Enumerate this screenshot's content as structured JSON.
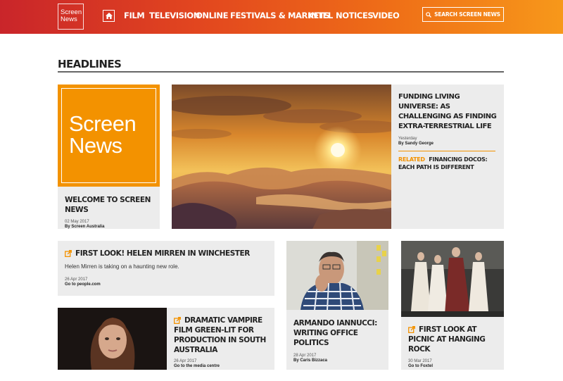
{
  "header": {
    "logo_line1": "Screen",
    "logo_line2": "News",
    "nav": [
      "FILM",
      "TELEVISION",
      "ONLINE",
      "FESTIVALS & MARKETS",
      "INTEL",
      "NOTICES",
      "VIDEO"
    ],
    "search_label": "SEARCH SCREEN NEWS"
  },
  "section": {
    "title": "HEADLINES"
  },
  "welcome": {
    "logo_line1": "Screen",
    "logo_line2": "News",
    "title": "WELCOME TO SCREEN NEWS",
    "date": "02 May 2017",
    "byline": "By Screen Australia"
  },
  "feature": {
    "title": "FUNDING LIVING UNIVERSE: AS CHALLENGING AS FINDING EXTRA-TERRESTRIAL LIFE",
    "date": "Yesterday",
    "byline": "By Sandy George",
    "related_label": "RELATED",
    "related_title": "FINANCING DOCOS: EACH PATH IS DIFFERENT"
  },
  "mirren": {
    "title": "FIRST LOOK! HELEN MIRREN IN WINCHESTER",
    "summary": "Helen Mirren is taking on a haunting new role.",
    "date": "26 Apr 2017",
    "byline": "Go to people.com"
  },
  "vampire": {
    "title": "DRAMATIC VAMPIRE FILM GREEN-LIT FOR PRODUCTION IN SOUTH AUSTRALIA",
    "date": "26 Apr 2017",
    "byline": "Go to the media centre"
  },
  "iannucci": {
    "title": "ARMANDO IANNUCCI: WRITING OFFICE POLITICS",
    "date": "28 Apr 2017",
    "byline": "By Caris Bizzaca"
  },
  "picnic": {
    "title": "FIRST LOOK AT PICNIC AT HANGING ROCK",
    "date": "30 Mar 2017",
    "byline": "Go to Foxtel"
  },
  "colors": {
    "accent": "#f39200",
    "brand_red": "#c9252a",
    "card_bg": "#ececec"
  }
}
